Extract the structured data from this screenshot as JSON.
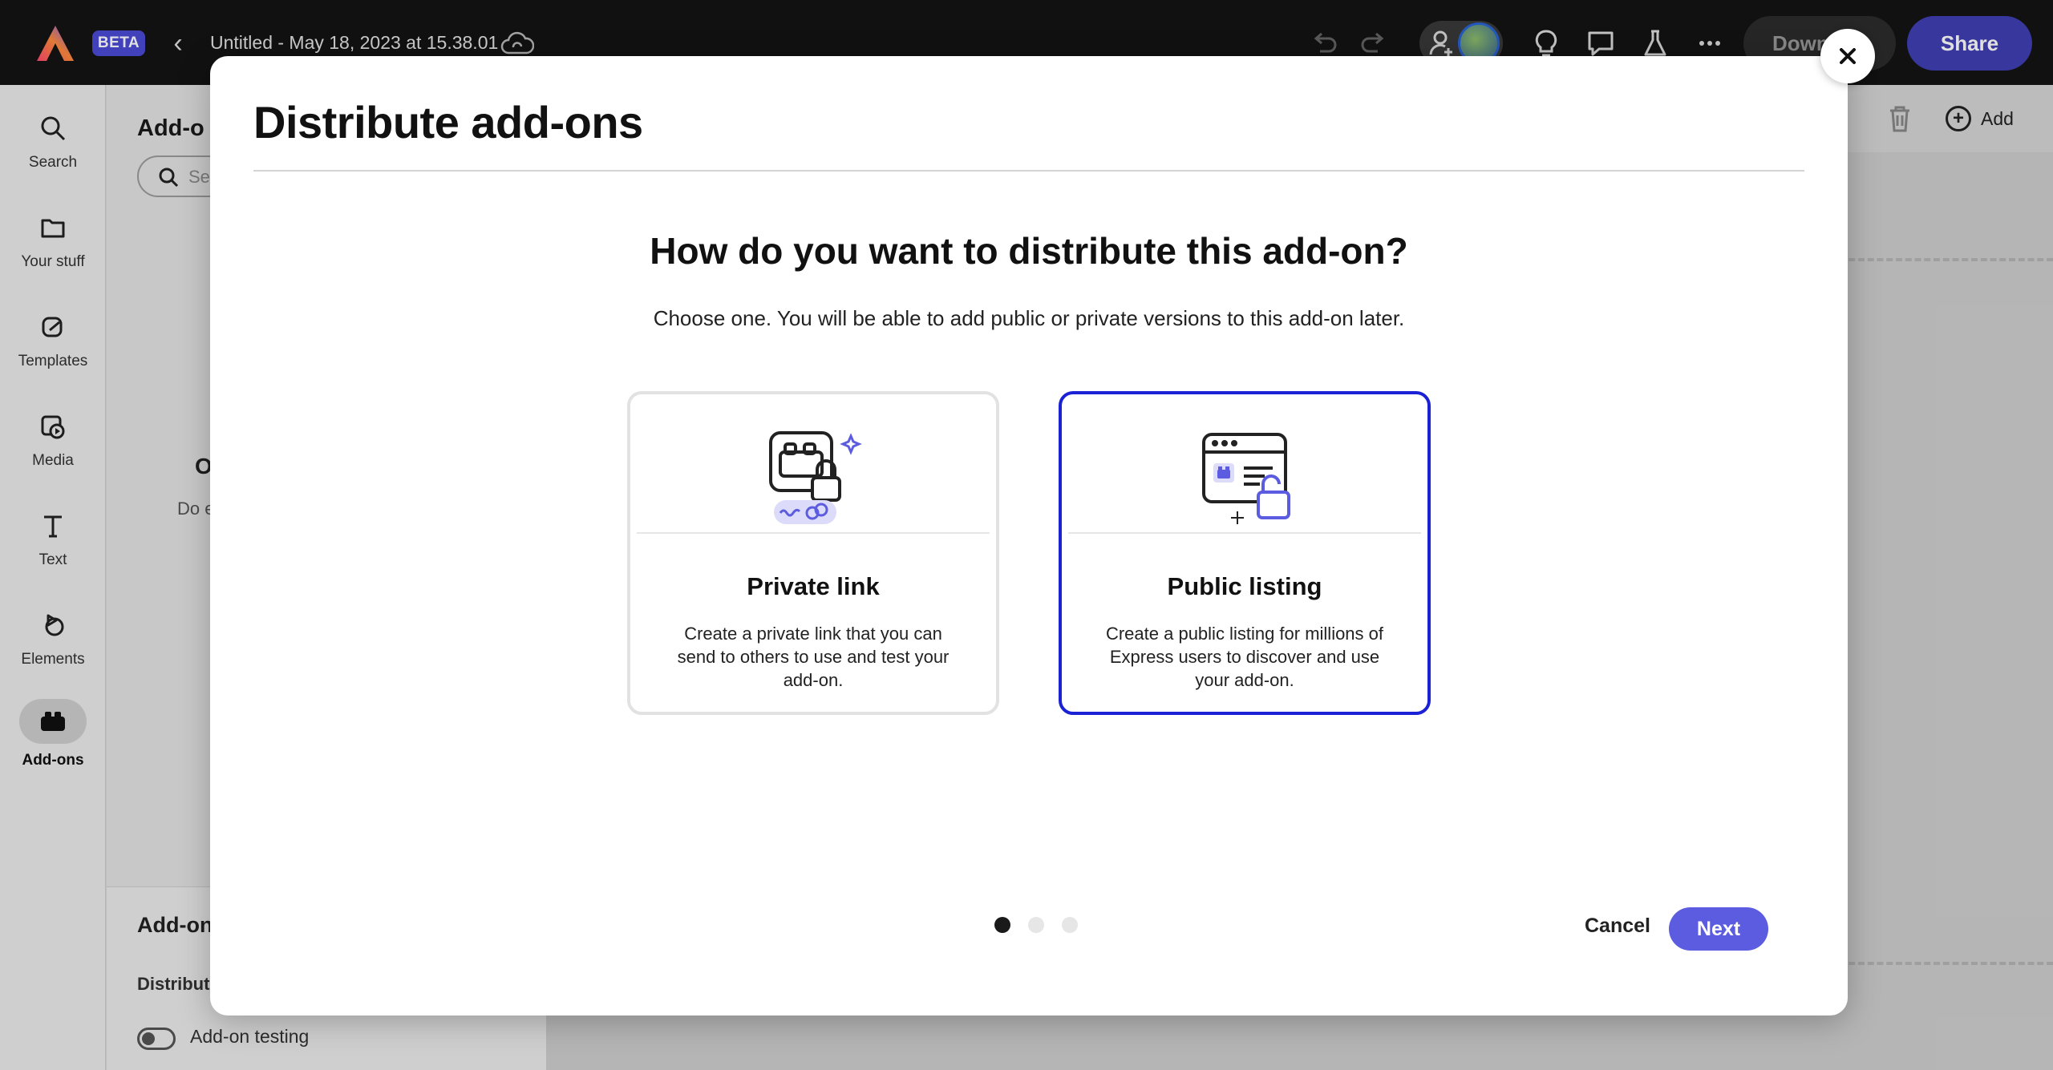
{
  "topbar": {
    "beta_label": "BETA",
    "doc_title": "Untitled - May 18, 2023 at 15.38.01",
    "download_label": "Down",
    "share_label": "Share",
    "icons": [
      "back-icon",
      "cloud-sync-icon",
      "undo-icon",
      "redo-icon",
      "invite-user-icon",
      "avatar",
      "lightbulb-icon",
      "comment-icon",
      "flask-icon",
      "more-icon"
    ]
  },
  "rail": {
    "items": [
      {
        "label": "Search",
        "icon": "search-icon"
      },
      {
        "label": "Your stuff",
        "icon": "folder-icon"
      },
      {
        "label": "Templates",
        "icon": "templates-icon"
      },
      {
        "label": "Media",
        "icon": "media-icon"
      },
      {
        "label": "Text",
        "icon": "text-icon"
      },
      {
        "label": "Elements",
        "icon": "elements-icon"
      },
      {
        "label": "Add-ons",
        "icon": "addons-icon",
        "active": true
      }
    ]
  },
  "panel": {
    "title": "Add-o",
    "search_placeholder": "Se",
    "big_letter": "O",
    "small_text": "Do e",
    "bottom_title": "Add-on",
    "bottom_sub": "Distribut",
    "toggle_label": "Add-on testing"
  },
  "canvas": {
    "add_label": "Add"
  },
  "modal": {
    "title": "Distribute add-ons",
    "question": "How do you want to distribute this add-on?",
    "subline": "Choose one. You will be able to add public or private versions to this add-on later.",
    "cards": [
      {
        "title": "Private link",
        "description": "Create a private link that you can send to others to use and test your add-on.",
        "selected": false,
        "icon": "private-link-illustration"
      },
      {
        "title": "Public listing",
        "description": "Create a public listing for millions of Express users to discover and use your add-on.",
        "selected": true,
        "icon": "public-listing-illustration"
      }
    ],
    "step": {
      "current": 1,
      "total": 3
    },
    "cancel_label": "Cancel",
    "next_label": "Next"
  },
  "colors": {
    "accent": "#5c5ce0",
    "selected_border": "#1b22d6",
    "share": "#3f3fb4",
    "topbar": "#141414"
  }
}
